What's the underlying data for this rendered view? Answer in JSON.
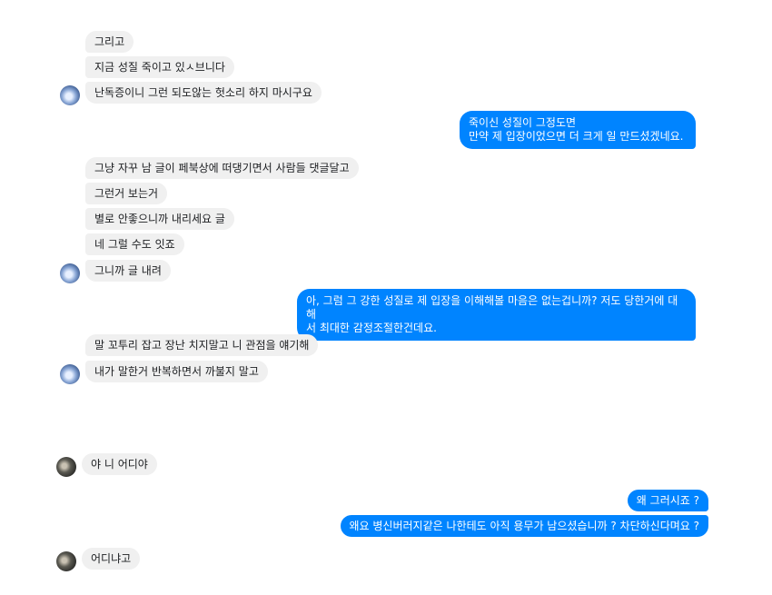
{
  "messages": {
    "m1": "그리고",
    "m2": "지금 성질 죽이고 있ㅅ브니다",
    "m3": "난독증이니 그런 되도않는 헛소리 하지 마시구요",
    "m4_line1": "죽이신 성질이 그정도면",
    "m4_line2": "만약 제 입장이었으면 더 크게 일 만드셨겠네요.",
    "m5": "그냥 자꾸 남 글이 페북상에 떠댕기면서 사람들 댓글달고",
    "m6": "그런거 보는거",
    "m7": "별로 안좋으니까 내리세요 글",
    "m8": "네 그럴 수도 잇죠",
    "m9": "그니까 글 내려",
    "m10_line1": "아, 그럼 그 강한 성질로 제 입장을 이해해볼 마음은 없는겁니까? 저도 당한거에 대해",
    "m10_line2": "서 최대한 감정조절한건데요.",
    "m11": "말 꼬투리 잡고 장난 치지말고 니 관점을 얘기해",
    "m12": "내가 말한거 반복하면서 까불지 말고",
    "m13": "야 니 어디야",
    "m14": "왜 그러시죠 ?",
    "m15": "왜요 병신버러지같은 나한테도 아직 용무가 남으셨습니까 ? 차단하신다며요 ?",
    "m16": "어디냐고"
  },
  "colors": {
    "incoming_bubble": "#f0f0f0",
    "outgoing_bubble": "#0084ff",
    "incoming_text": "#1c1e21",
    "outgoing_text": "#ffffff"
  }
}
